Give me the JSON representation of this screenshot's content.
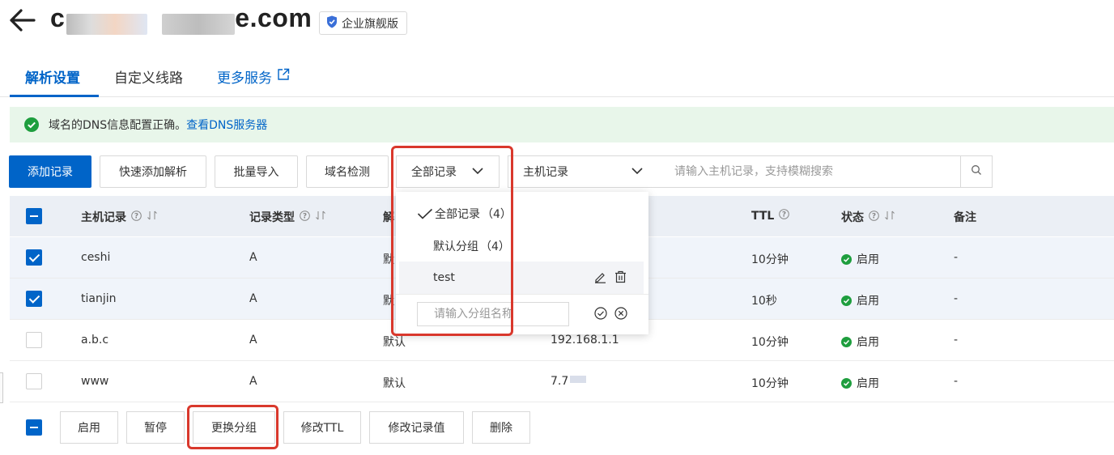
{
  "header": {
    "domain_prefix": "c",
    "domain_suffix": "e.com",
    "edition": "企业旗舰版"
  },
  "tabs": [
    {
      "label": "解析设置"
    },
    {
      "label": "自定义线路"
    },
    {
      "label": "更多服务"
    }
  ],
  "alert": {
    "text": "域名的DNS信息配置正确。",
    "link": "查看DNS服务器"
  },
  "toolbar": {
    "add": "添加记录",
    "quick_add": "快速添加解析",
    "import": "批量导入",
    "check": "域名检测",
    "group_select": "全部记录",
    "field_select": "主机记录",
    "search_placeholder": "请输入主机记录，支持模糊搜索"
  },
  "table": {
    "headers": {
      "host": "主机记录",
      "type": "记录类型",
      "line": "解",
      "ttl": "TTL",
      "status": "状态",
      "remark": "备注"
    },
    "rows": [
      {
        "host": "ceshi",
        "type": "A",
        "line": "默",
        "value": "",
        "ttl": "10分钟",
        "status": "启用",
        "remark": "-",
        "checked": true
      },
      {
        "host": "tianjin",
        "type": "A",
        "line": "默",
        "value": "",
        "ttl": "10秒",
        "status": "启用",
        "remark": "-",
        "checked": true
      },
      {
        "host": "a.b.c",
        "type": "A",
        "line": "默认",
        "value": "192.168.1.1",
        "ttl": "10分钟",
        "status": "启用",
        "remark": "-",
        "checked": false
      },
      {
        "host": "www",
        "type": "A",
        "line": "默认",
        "value": "7.7",
        "ttl": "10分钟",
        "status": "启用",
        "remark": "-",
        "checked": false
      }
    ]
  },
  "dropdown": {
    "items": [
      {
        "label": "全部记录",
        "count": "（4）"
      },
      {
        "label": "默认分组",
        "count": "（4）"
      },
      {
        "label": "test",
        "count": ""
      }
    ],
    "input_placeholder": "请输入分组名称"
  },
  "bulk_actions": {
    "enable": "启用",
    "pause": "暂停",
    "change_group": "更换分组",
    "edit_ttl": "修改TTL",
    "edit_value": "修改记录值",
    "delete": "删除"
  },
  "colors": {
    "primary": "#0064c8",
    "success": "#1e9e3e",
    "highlight": "#d9382c"
  }
}
